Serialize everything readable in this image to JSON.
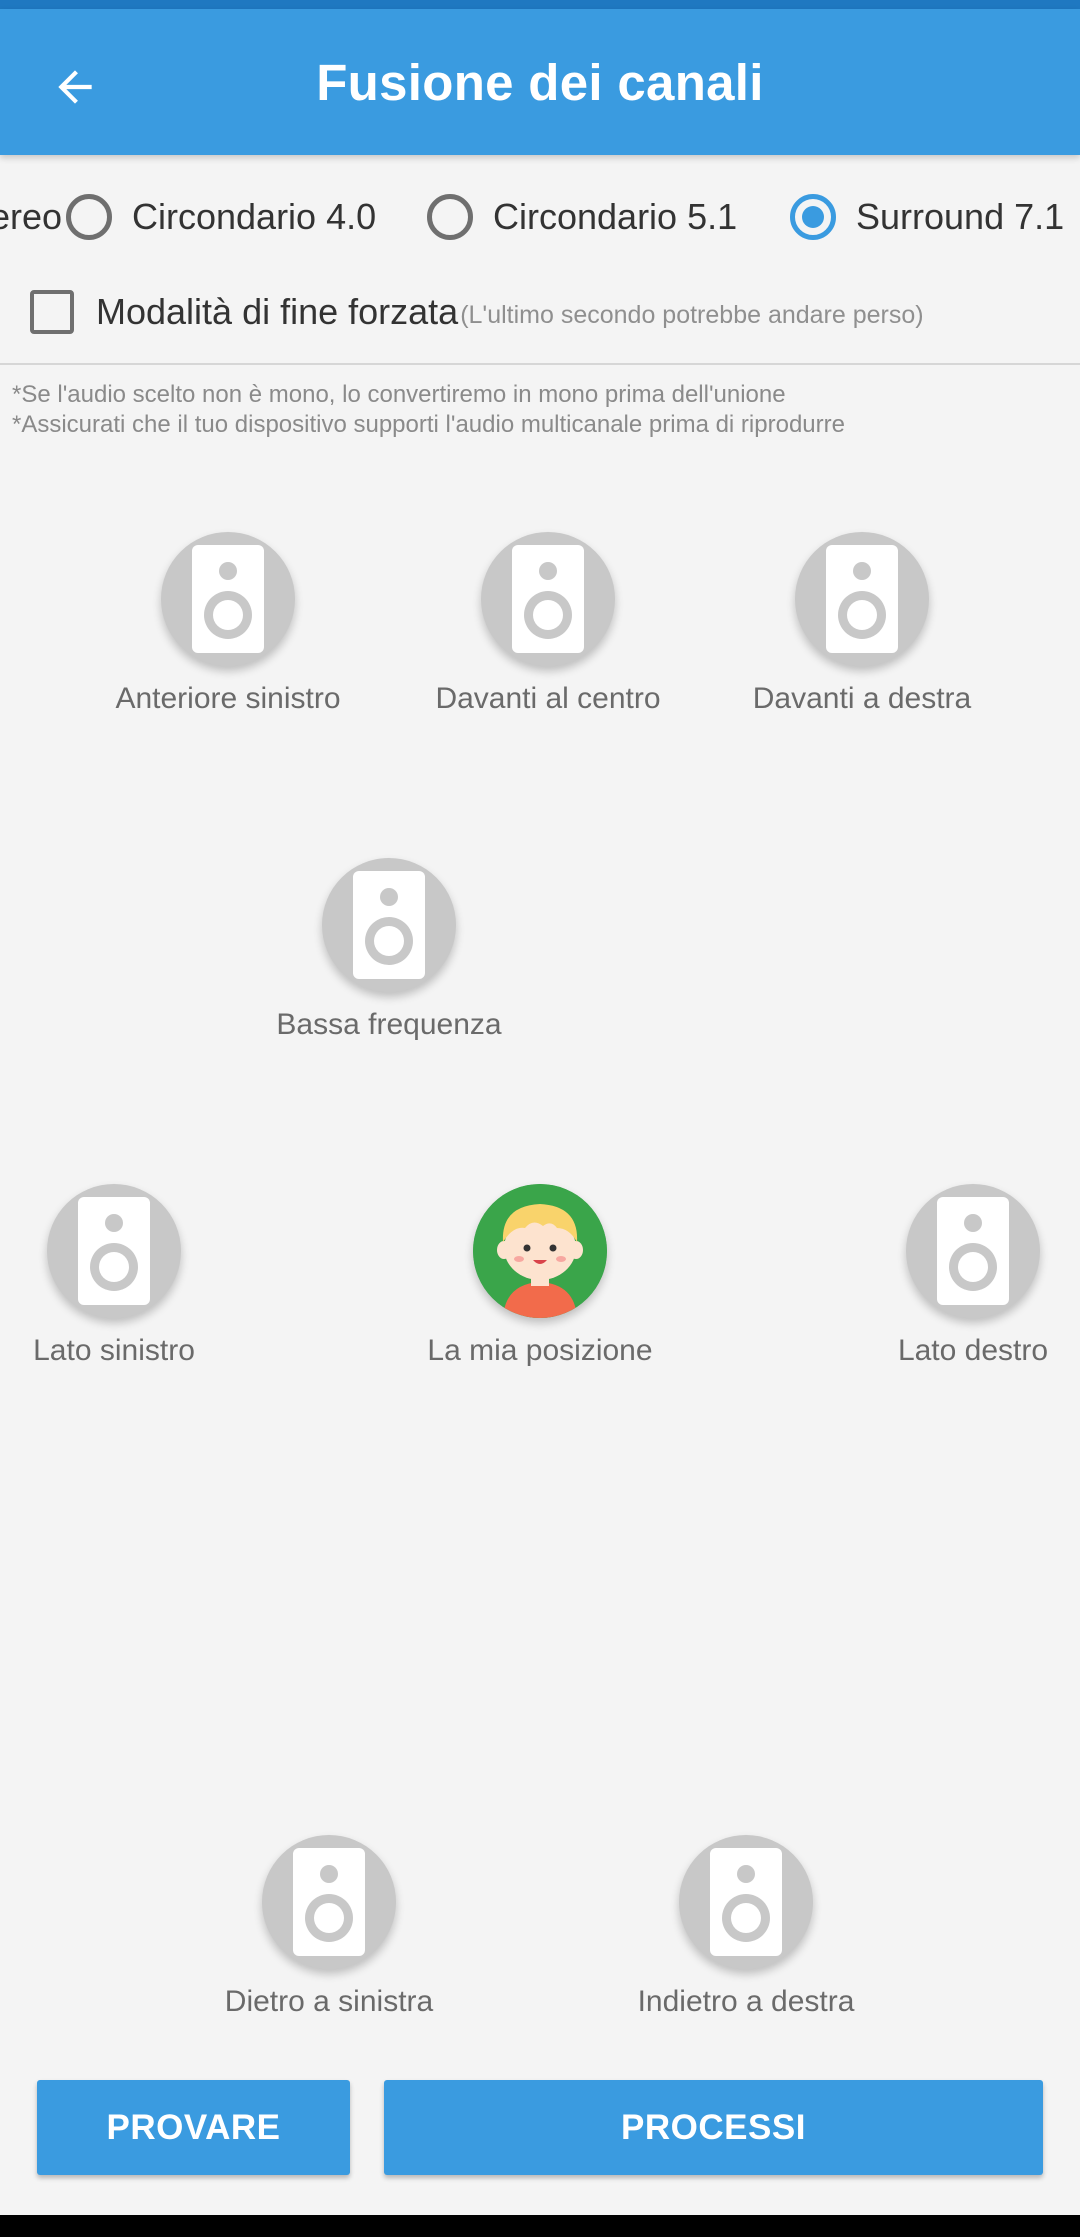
{
  "app": {
    "title": "Fusione dei canali"
  },
  "modes": {
    "clipped_label": "Stereo",
    "options": [
      {
        "label": "Circondario 4.0",
        "checked": false
      },
      {
        "label": "Circondario 5.1",
        "checked": false
      },
      {
        "label": "Surround 7.1",
        "checked": true
      }
    ]
  },
  "force_end": {
    "label": "Modalità di fine forzata",
    "hint": "(L'ultimo secondo potrebbe andare perso)",
    "checked": false
  },
  "notes": [
    "*Se l'audio scelto non è mono, lo convertiremo in mono prima dell'unione",
    "*Assicurati che il tuo dispositivo supporti l'audio multicanale prima di riprodurre"
  ],
  "speakers": {
    "front_left": "Anteriore sinistro",
    "front_center": "Davanti al centro",
    "front_right": "Davanti a destra",
    "low_frequency": "Bassa frequenza",
    "side_left": "Lato sinistro",
    "my_position": "La mia posizione",
    "side_right": "Lato destro",
    "back_left": "Dietro a sinistra",
    "back_right": "Indietro a destra"
  },
  "buttons": {
    "try": "PROVARE",
    "process": "PROCESSI"
  },
  "colors": {
    "primary": "#3a9be0",
    "speaker_bg": "#c8c8c8",
    "avatar_bg": "#3aa54a"
  }
}
